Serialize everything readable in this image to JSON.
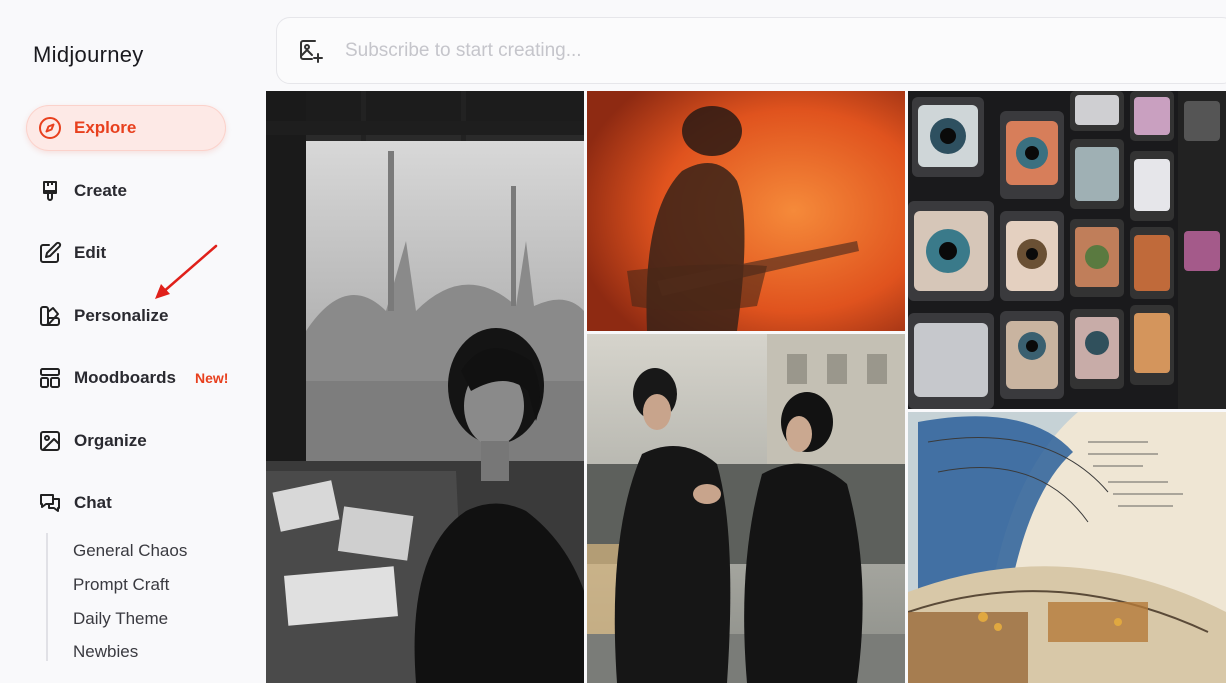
{
  "app": {
    "title": "Midjourney"
  },
  "nav": {
    "explore": "Explore",
    "create": "Create",
    "edit": "Edit",
    "personalize": "Personalize",
    "moodboards": "Moodboards",
    "moodboards_badge": "New!",
    "organize": "Organize",
    "chat": "Chat"
  },
  "chat_channels": [
    "General Chaos",
    "Prompt Craft",
    "Daily Theme",
    "Newbies"
  ],
  "search": {
    "placeholder": "Subscribe to start creating..."
  },
  "colors": {
    "accent": "#e8401e",
    "accent_bg": "#fde9e6",
    "annotation_arrow": "#e0201a"
  },
  "gallery": [
    {
      "icon": "photo-bw-woman-window"
    },
    {
      "icon": "photo-guitarist-orange"
    },
    {
      "icon": "photo-tv-wall-eyes"
    },
    {
      "icon": "photo-couple-street"
    },
    {
      "icon": "photo-architecture-sketch"
    }
  ]
}
